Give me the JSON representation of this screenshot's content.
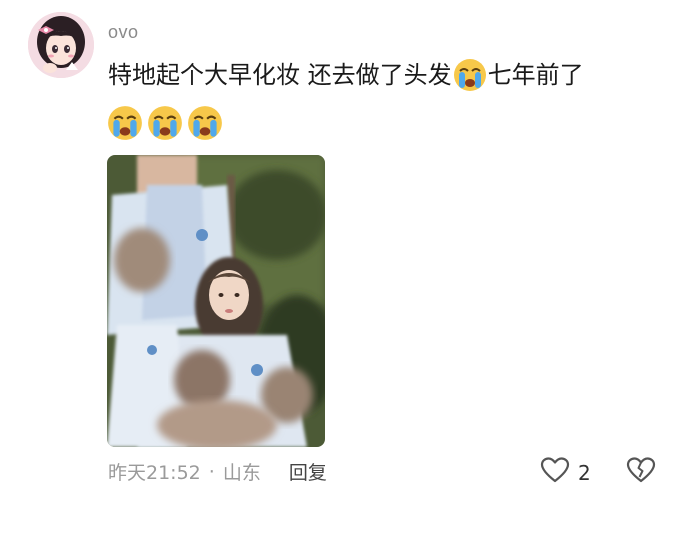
{
  "comment": {
    "username": "ovo",
    "text_part1": "特地起个大早化妆 还去做了头发",
    "text_part2": "七年前了",
    "inline_emoji": "crying-face-emoji",
    "emoji_row": [
      "crying-face-emoji",
      "crying-face-emoji",
      "crying-face-emoji"
    ],
    "photo": "blurred-group-photo",
    "meta": {
      "time": "昨天21:52",
      "separator": "·",
      "location": "山东",
      "reply_label": "回复"
    },
    "like_count": "2"
  },
  "colors": {
    "username": "#8a8a8a",
    "meta": "#9a9a9a",
    "text": "#1a1a1a"
  }
}
